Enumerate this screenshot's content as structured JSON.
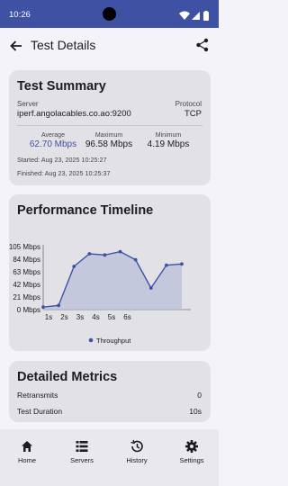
{
  "status_bar": {
    "time": "10:26"
  },
  "app_bar": {
    "title": "Test Details"
  },
  "summary": {
    "title": "Test Summary",
    "server_label": "Server",
    "server_value": "iperf.angolacables.co.ao:9200",
    "protocol_label": "Protocol",
    "protocol_value": "TCP",
    "average_label": "Average",
    "average_value": "62.70 Mbps",
    "maximum_label": "Maximum",
    "maximum_value": "96.58 Mbps",
    "minimum_label": "Minimum",
    "minimum_value": "4.19 Mbps",
    "started": "Started: Aug 23, 2025 10:25:27",
    "finished": "Finished: Aug 23, 2025 10:25:37"
  },
  "timeline": {
    "title": "Performance Timeline"
  },
  "chart_data": {
    "type": "area",
    "title": "",
    "xlabel": "",
    "ylabel": "",
    "y_ticks": [
      "0 Mbps",
      "21 Mbps",
      "42 Mbps",
      "63 Mbps",
      "84 Mbps",
      "105 Mbps"
    ],
    "x_ticks": [
      "1s",
      "2s",
      "3s",
      "4s",
      "5s",
      "6s"
    ],
    "ylim": [
      0,
      105
    ],
    "series": [
      {
        "name": "Throughput",
        "x": [
          0,
          1,
          2,
          3,
          4,
          5,
          6,
          7,
          8,
          9
        ],
        "y": [
          4.19,
          7,
          72,
          93,
          91,
          96.58,
          83,
          36,
          74,
          76
        ]
      }
    ],
    "legend_position": "bottom",
    "colors": {
      "line": "#3f51a3",
      "fill": "#b9bfd8"
    }
  },
  "metrics": {
    "title": "Detailed Metrics",
    "retransmits_label": "Retransmits",
    "retransmits_value": "0",
    "duration_label": "Test Duration",
    "duration_value": "10s"
  },
  "nav": {
    "home": "Home",
    "servers": "Servers",
    "history": "History",
    "settings": "Settings"
  },
  "colors": {
    "accent": "#3f51a3",
    "status_bar": "#3f51a3"
  }
}
